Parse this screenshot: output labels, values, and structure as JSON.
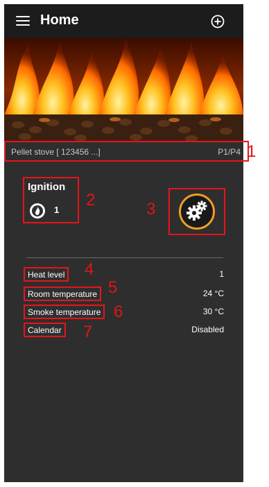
{
  "header": {
    "title": "Home"
  },
  "device": {
    "name": "Pellet stove [ 123456 ...]",
    "page": "P1/P4"
  },
  "ignition": {
    "title": "Ignition",
    "value": "1"
  },
  "rows": [
    {
      "label": "Heat level",
      "value": "1"
    },
    {
      "label": "Room temperature",
      "value": "24 °C"
    },
    {
      "label": "Smoke temperature",
      "value": "30 °C"
    },
    {
      "label": "Calendar",
      "value": "Disabled"
    }
  ],
  "callouts": [
    "1",
    "2",
    "3",
    "4",
    "5",
    "6",
    "7"
  ],
  "colors": {
    "accent": "#f0a020",
    "annotation": "#e8141a",
    "background": "#2e2e2e",
    "topbar": "#1c1c1c"
  },
  "icons": {
    "menu": "hamburger-icon",
    "add": "plus-circle-icon",
    "flame": "flame-icon",
    "settings": "gears-icon"
  }
}
